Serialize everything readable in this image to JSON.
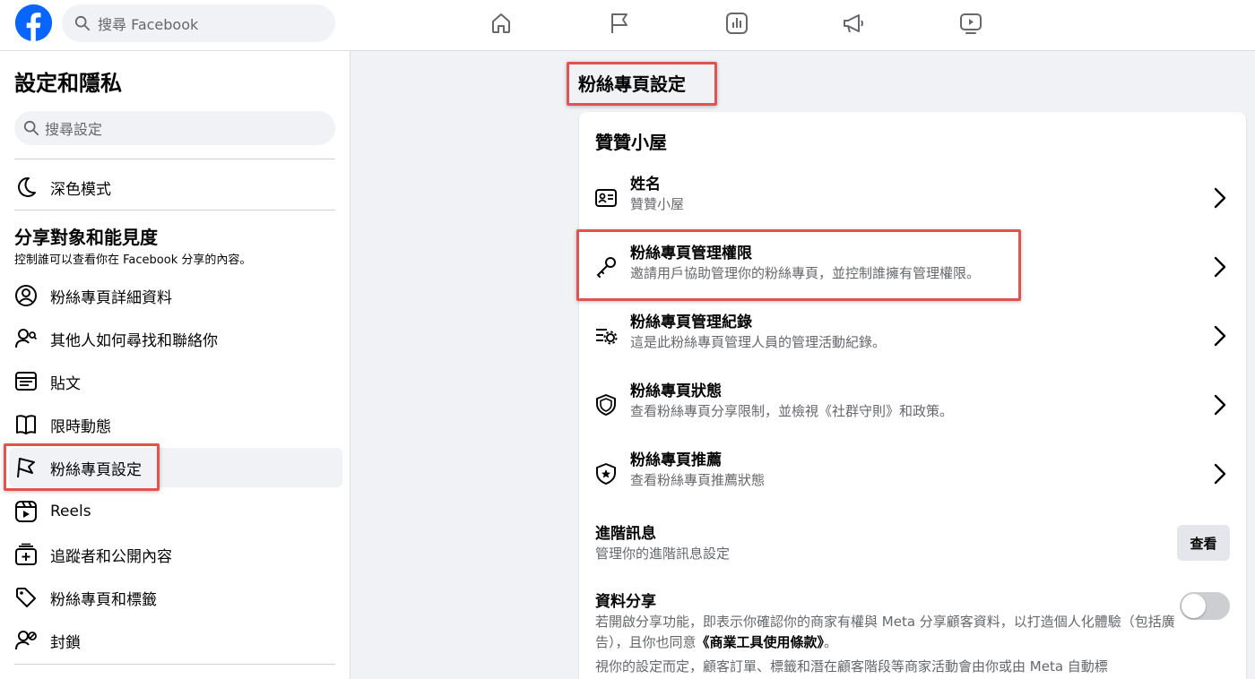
{
  "topbar": {
    "search_placeholder": "搜尋 Facebook",
    "nav_icons": [
      "home-icon",
      "flag-icon",
      "insights-icon",
      "megaphone-icon",
      "video-icon"
    ]
  },
  "sidebar": {
    "title": "設定和隱私",
    "search_placeholder": "搜尋設定",
    "dark_mode": "深色模式",
    "section_title": "分享對象和能見度",
    "section_sub": "控制誰可以查看你在 Facebook 分享的內容。",
    "items": [
      {
        "label": "粉絲專頁詳細資料",
        "icon": "profile-icon"
      },
      {
        "label": "其他人如何尋找和聯絡你",
        "icon": "people-search-icon"
      },
      {
        "label": "貼文",
        "icon": "posts-icon"
      },
      {
        "label": "限時動態",
        "icon": "book-icon"
      },
      {
        "label": "粉絲專頁設定",
        "icon": "flag-icon"
      },
      {
        "label": "Reels",
        "icon": "reels-icon"
      },
      {
        "label": "追蹤者和公開內容",
        "icon": "add-follower-icon"
      },
      {
        "label": "粉絲專頁和標籤",
        "icon": "tag-icon"
      },
      {
        "label": "封鎖",
        "icon": "block-icon"
      }
    ]
  },
  "main": {
    "title": "粉絲專頁設定",
    "card_title": "贊贊小屋",
    "rows": [
      {
        "title": "姓名",
        "sub": "贊贊小屋",
        "icon": "id-card-icon"
      },
      {
        "title": "粉絲專頁管理權限",
        "sub": "邀請用戶協助管理你的粉絲專頁，並控制誰擁有管理權限。",
        "icon": "key-icon"
      },
      {
        "title": "粉絲專頁管理紀錄",
        "sub": "這是此粉絲專頁管理人員的管理活動紀錄。",
        "icon": "activity-log-icon"
      },
      {
        "title": "粉絲專頁狀態",
        "sub": "查看粉絲專頁分享限制，並檢視《社群守則》和政策。",
        "icon": "shield-icon"
      },
      {
        "title": "粉絲專頁推薦",
        "sub": "查看粉絲專頁推薦狀態",
        "icon": "star-shield-icon"
      }
    ],
    "advanced": {
      "title": "進階訊息",
      "sub": "管理你的進階訊息設定",
      "button": "查看"
    },
    "data_sharing": {
      "title": "資料分享",
      "text_a": "若開啟分享功能，即表示你確認你的商家有權與 Meta 分享顧客資料，以打造個人化體驗（包括廣告），且你也同意",
      "text_link": "《商業工具使用條款》",
      "text_b": "。",
      "text_2": "視你的設定而定，顧客訂單、標籤和潛在顧客階段等商家活動會由你或由 Meta 自動標",
      "toggle_on": false
    }
  },
  "colors": {
    "brand": "#0866ff",
    "highlight": "#e0544f"
  }
}
